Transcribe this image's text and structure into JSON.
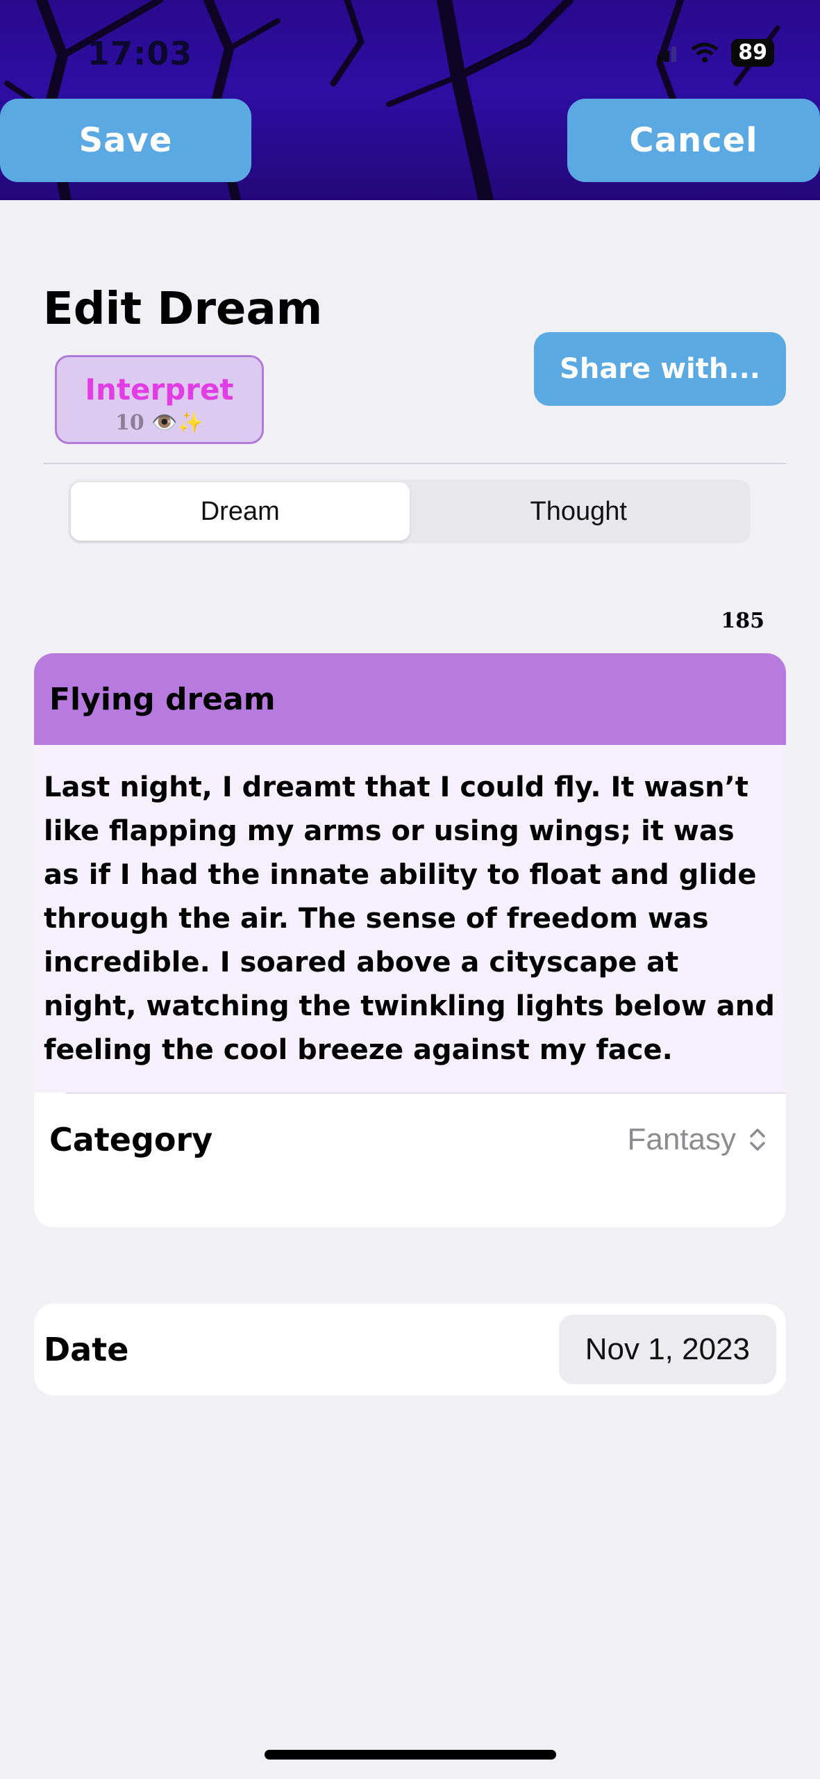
{
  "status_bar": {
    "time": "17:03",
    "battery": "89"
  },
  "toolbar": {
    "save_label": "Save",
    "cancel_label": "Cancel"
  },
  "page": {
    "title": "Edit Dream"
  },
  "interpret": {
    "label": "Interpret",
    "cost": "10 👁️✨"
  },
  "share": {
    "label": "Share with..."
  },
  "segments": [
    {
      "label": "Dream",
      "selected": true
    },
    {
      "label": "Thought",
      "selected": false
    }
  ],
  "editor": {
    "char_count": "185",
    "title": "Flying dream",
    "body": "Last night, I dreamt that I could fly. It wasn’t like flapping my arms or using wings; it was as if I had the innate ability to float and glide through the air. The sense of freedom was incredible. I soared above a cityscape at night, watching the twinkling lights below and feeling the cool breeze against my face."
  },
  "category": {
    "label": "Category",
    "value": "Fantasy"
  },
  "date": {
    "label": "Date",
    "value": "Nov 1, 2023"
  },
  "colors": {
    "accent_blue": "#5aa9e2",
    "title_bar_purple": "#b77be0",
    "interpret_pink": "#e23ce4",
    "header_purple": "#2d0ea3"
  }
}
